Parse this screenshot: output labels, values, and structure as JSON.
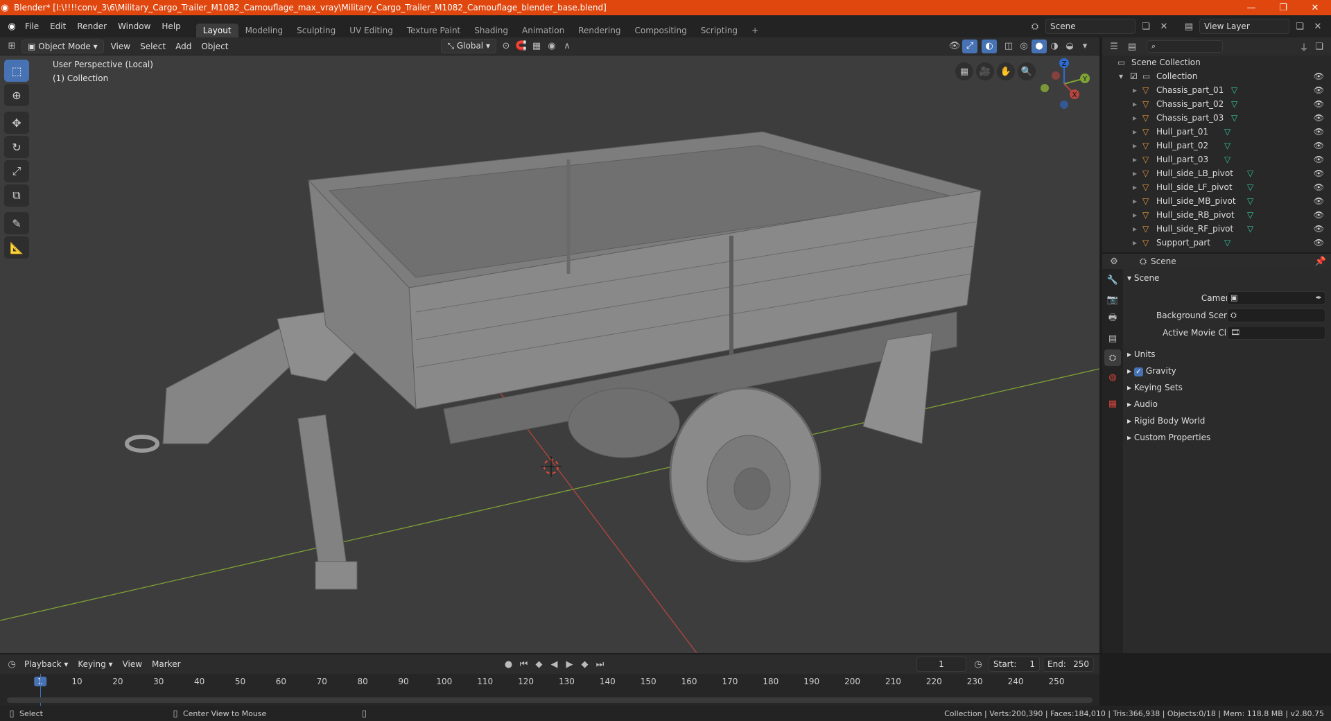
{
  "titlebar": {
    "title": "Blender* [I:\\!!!!conv_3\\6\\Military_Cargo_Trailer_M1082_Camouflage_max_vray\\Military_Cargo_Trailer_M1082_Camouflage_blender_base.blend]",
    "minimize": "—",
    "maximize": "❐",
    "close": "✕"
  },
  "menu": {
    "items": [
      "File",
      "Edit",
      "Render",
      "Window",
      "Help"
    ]
  },
  "workspaces": {
    "tabs": [
      "Layout",
      "Modeling",
      "Sculpting",
      "UV Editing",
      "Texture Paint",
      "Shading",
      "Animation",
      "Rendering",
      "Compositing",
      "Scripting"
    ],
    "add": "+"
  },
  "scene_selector": {
    "value": "Scene"
  },
  "view_layer": {
    "value": "View Layer"
  },
  "viewport_header": {
    "mode": "Object Mode",
    "menus": [
      "View",
      "Select",
      "Add",
      "Object"
    ],
    "orientation": "Global"
  },
  "viewport": {
    "perspective": "User Perspective (Local)",
    "collection": "(1) Collection",
    "gizmo": {
      "z": "Z",
      "y": "Y",
      "x": "X"
    }
  },
  "outliner": {
    "search_placeholder": "",
    "scene_collection": "Scene Collection",
    "collection": "Collection",
    "objects": [
      "Chassis_part_01",
      "Chassis_part_02",
      "Chassis_part_03",
      "Hull_part_01",
      "Hull_part_02",
      "Hull_part_03",
      "Hull_side_LB_pivot",
      "Hull_side_LF_pivot",
      "Hull_side_MB_pivot",
      "Hull_side_RB_pivot",
      "Hull_side_RF_pivot",
      "Support_part"
    ]
  },
  "properties": {
    "context": "Scene",
    "panel_title": "Scene",
    "fields": {
      "camera": "Camera",
      "background_scene": "Background Scene",
      "active_movie_clip": "Active Movie Clip"
    },
    "sections": [
      "Units",
      "Gravity",
      "Keying Sets",
      "Audio",
      "Rigid Body World",
      "Custom Properties"
    ]
  },
  "timeline": {
    "menus": [
      "Playback",
      "Keying",
      "View",
      "Marker"
    ],
    "current_frame": "1",
    "start_label": "Start:",
    "start": "1",
    "end_label": "End:",
    "end": "250",
    "ticks": [
      "1",
      "10",
      "20",
      "30",
      "40",
      "50",
      "60",
      "70",
      "80",
      "90",
      "100",
      "110",
      "120",
      "130",
      "140",
      "150",
      "160",
      "170",
      "180",
      "190",
      "200",
      "210",
      "220",
      "230",
      "240",
      "250"
    ]
  },
  "statusbar": {
    "left": "Select",
    "middle": "Center View to Mouse",
    "right": "Collection | Verts:200,390 | Faces:184,010 | Tris:366,938 | Objects:0/18 | Mem: 118.8 MB | v2.80.75"
  },
  "colors": {
    "title_bg": "#e0470f",
    "accent": "#4772b3",
    "object_icon": "#e89a3c",
    "mesh_icon": "#35c6a1",
    "x_axis": "#b5453f",
    "y_axis": "#7fa235"
  }
}
